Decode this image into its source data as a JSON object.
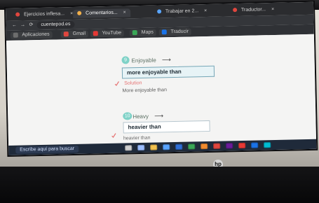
{
  "browser": {
    "tabs": [
      {
        "label": "Ejercicios inflesa..."
      },
      {
        "label": "Comentarios..."
      },
      {
        "label": "Trabajar en 2..."
      },
      {
        "label": "Traductor..."
      }
    ],
    "nav": {
      "back": "←",
      "forward": "→",
      "reload": "⟳"
    },
    "url": "cuentepod.es",
    "bookmarks": [
      {
        "label": "Aplicaciones"
      },
      {
        "label": "Gmail"
      },
      {
        "label": "YouTube"
      },
      {
        "label": "Maps"
      },
      {
        "label": "Traducir"
      }
    ]
  },
  "exercise": {
    "item1": {
      "number": "9",
      "prompt": "Enjoyable",
      "answer": "more enjoyable than",
      "solution_label": "Solution",
      "solution_text": "More enjoyable than"
    },
    "item2": {
      "number": "10",
      "prompt": "Heavy",
      "answer": "heavier than",
      "solution_text": "heavier than"
    }
  },
  "taskbar": {
    "search_placeholder": "Escribe aquí para buscar"
  },
  "brand": {
    "logo": "hp"
  },
  "colors": {
    "accent_teal": "#7fd2c7",
    "answer_border": "#76a6b6",
    "taskbar_bg": "#1f2a3a"
  }
}
